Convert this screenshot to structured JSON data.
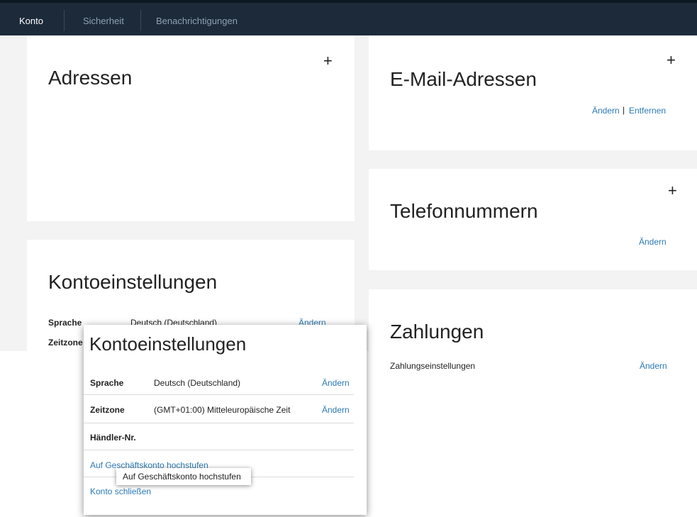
{
  "nav": {
    "tabs": [
      {
        "label": "Konto"
      },
      {
        "label": "Sicherheit"
      },
      {
        "label": "Benachrichtigungen"
      }
    ]
  },
  "addresses": {
    "title": "Adressen",
    "add_label": "+"
  },
  "emails": {
    "title": "E-Mail-Adressen",
    "add_label": "+",
    "edit_label": "Ändern",
    "divider": "|",
    "remove_label": "Entfernen"
  },
  "phones": {
    "title": "Telefonnummern",
    "add_label": "+",
    "edit_label": "Ändern"
  },
  "account_settings": {
    "title": "Kontoeinstellungen",
    "rows": [
      {
        "label": "Sprache",
        "value": "Deutsch (Deutschland)",
        "action": "Ändern"
      },
      {
        "label": "Zeitzone",
        "value": "",
        "action": ""
      }
    ]
  },
  "payments": {
    "title": "Zahlungen",
    "row_label": "Zahlungseinstellungen",
    "edit_label": "Ändern"
  },
  "popup": {
    "title": "Kontoeinstellungen",
    "rows": [
      {
        "label": "Sprache",
        "value": "Deutsch (Deutschland)",
        "action": "Ändern"
      },
      {
        "label": "Zeitzone",
        "value": "(GMT+01:00) Mitteleuropäische Zeit",
        "action": "Ändern"
      },
      {
        "label": "Händler-Nr.",
        "value": "",
        "action": ""
      }
    ],
    "upgrade_link": "Auf Geschäftskonto hochstufen",
    "close_link": "Konto schließen",
    "tooltip": "Auf Geschäftskonto hochstufen"
  },
  "colors": {
    "nav_bg": "#1c2a3a",
    "link": "#2a7ab5",
    "page_bg": "#f3f3f3"
  }
}
